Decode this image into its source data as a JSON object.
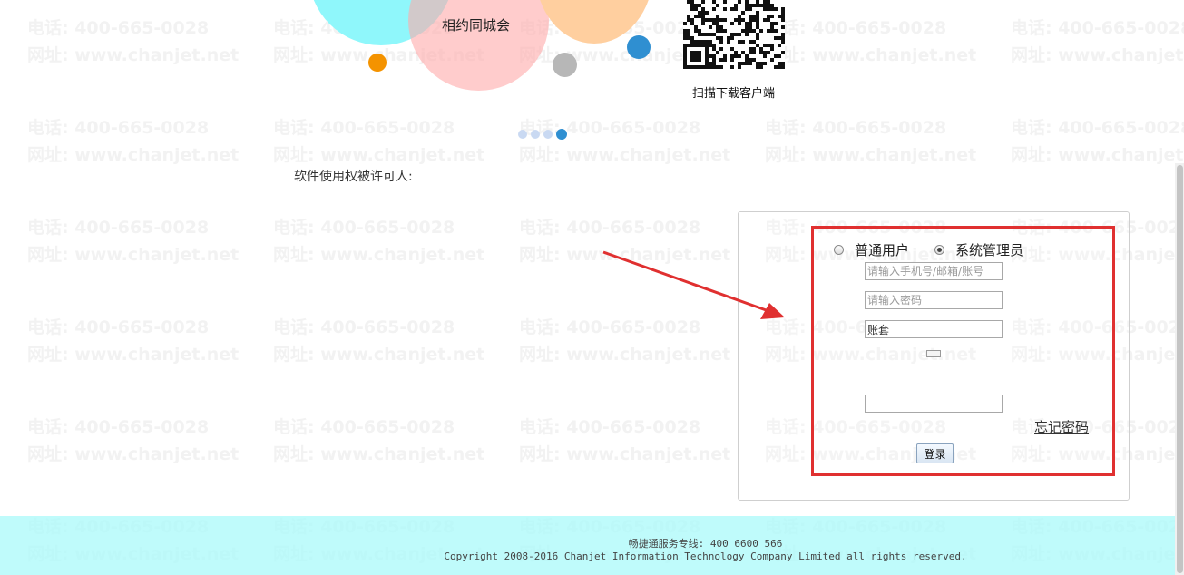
{
  "watermark": {
    "phone": "电话: 400-665-0028",
    "site": "网址: www.chanjet.net"
  },
  "banner": {
    "bubble_label": "相约同城会",
    "qr_caption": "扫描下载客户端",
    "carousel": {
      "count": 4,
      "active": 4
    }
  },
  "licensee_label": "软件使用权被许可人:",
  "login": {
    "radio_normal": "普通用户",
    "radio_admin": "系统管理员",
    "selected_role": "系统管理员",
    "account_placeholder": "请输入手机号/邮箱/账号",
    "password_placeholder": "请输入密码",
    "accountset_value": "账套",
    "captcha_value": "",
    "forgot_password": "忘记密码",
    "login_button": "登录"
  },
  "footer": {
    "hotline": "畅捷通服务专线: 400 6600 566",
    "copyright": "Copyright 2008-2016 Chanjet Information Technology Company Limited all rights reserved."
  },
  "colors": {
    "highlight": "#e03030",
    "footer_bg": "#aafafa",
    "accent_blue": "#2f8fd1"
  }
}
